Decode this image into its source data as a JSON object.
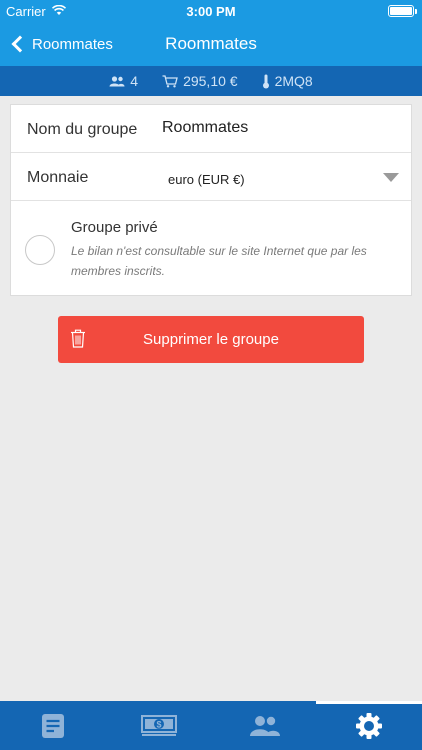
{
  "status_bar": {
    "carrier": "Carrier",
    "time": "3:00 PM"
  },
  "nav": {
    "back_label": "Roommates",
    "title": "Roommates"
  },
  "info_bar": {
    "members": "4",
    "total": "295,10 €",
    "code": "2MQ8"
  },
  "form": {
    "name_label": "Nom du groupe",
    "name_value": "Roommates",
    "currency_label": "Monnaie",
    "currency_value": "euro (EUR €)",
    "private_title": "Groupe privé",
    "private_desc": "Le bilan n'est consultable sur le site Internet que par les membres inscrits.",
    "private_checked": false
  },
  "delete_button": {
    "label": "Supprimer le groupe"
  },
  "tabs": [
    {
      "name": "list-icon",
      "active": false
    },
    {
      "name": "cash-icon",
      "active": false
    },
    {
      "name": "members-icon",
      "active": false
    },
    {
      "name": "gear-icon",
      "active": true
    }
  ],
  "colors": {
    "nav_bg": "#1b9ae2",
    "bar_bg": "#1466b3",
    "danger": "#f24a3e",
    "tab_inactive": "#8fb3d8",
    "tab_active": "#ffffff"
  }
}
